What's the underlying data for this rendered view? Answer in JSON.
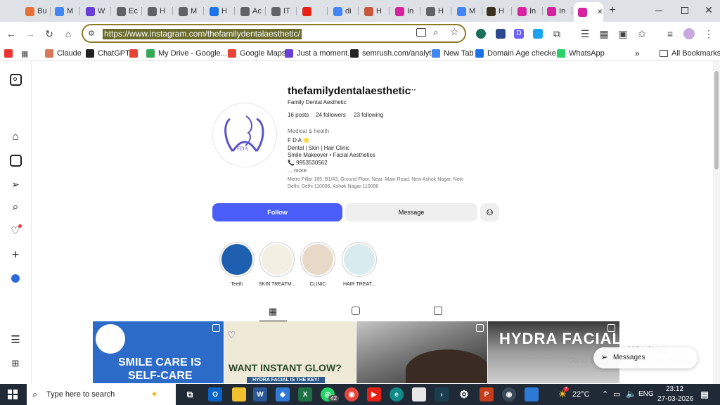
{
  "browser": {
    "tabs": [
      {
        "label": "Bu",
        "color": "#e8703a"
      },
      {
        "label": "M",
        "color": "#4285f4"
      },
      {
        "label": "W",
        "color": "#6a3fd6"
      },
      {
        "label": "Ec",
        "color": "#5f6368"
      },
      {
        "label": "H",
        "color": "#5f6368"
      },
      {
        "label": "M",
        "color": "#5f6368"
      },
      {
        "label": "H",
        "color": "#1a73e8"
      },
      {
        "label": "Ac",
        "color": "#5f6368"
      },
      {
        "label": "IT",
        "color": "#5f6368"
      },
      {
        "label": "",
        "color": "#e62117"
      },
      {
        "label": "di",
        "color": "#4285f4"
      },
      {
        "label": "H",
        "color": "#c8553d"
      },
      {
        "label": "In",
        "color": "#d6249f"
      },
      {
        "label": "H",
        "color": "#5f6368"
      },
      {
        "label": "M",
        "color": "#4285f4"
      },
      {
        "label": "H",
        "color": "#3b2f1e"
      },
      {
        "label": "In",
        "color": "#d6249f"
      },
      {
        "label": "In",
        "color": "#d6249f"
      },
      {
        "label": "",
        "color": "#d6249f"
      }
    ],
    "url": "https://www.instagram.com/thefamilydentalaesthetic/",
    "bookmarks": [
      {
        "label": "Claude",
        "color": "#d97757"
      },
      {
        "label": "ChatGPT",
        "color": "#222222"
      },
      {
        "label": "",
        "color": "#ea4335"
      },
      {
        "label": "My Drive - Google...",
        "color": "#34a853"
      },
      {
        "label": "Google Maps",
        "color": "#ea4335"
      },
      {
        "label": "Just a moment...",
        "color": "#6a3fd6"
      },
      {
        "label": "semrush.com/analyt...",
        "color": "#222222"
      },
      {
        "label": "New Tab",
        "color": "#4285f4"
      },
      {
        "label": "Domain Age checke...",
        "color": "#1a73e8"
      },
      {
        "label": "WhatsApp",
        "color": "#25d366"
      }
    ],
    "all_bookmarks": "All Bookmarks"
  },
  "profile": {
    "username": "thefamilydentalaesthetic",
    "more": "···",
    "display_name": "Family Dental Aesthetic",
    "posts": "16 posts",
    "followers": "24 followers",
    "following": "23 following",
    "category": "Medical & health",
    "bio_line1": "F D A 🌟",
    "bio_line2": "Dental | Skin | Hair Clinic",
    "bio_line3": "Smile Makeover • Facial Aesthetics",
    "bio_phone": "📞 9953530562",
    "bio_more": "... more",
    "address_line1": "Metro Pillar 165, B1/43, Ground Floor, Near, Main Road, New Ashok Nagar, New",
    "address_line2": "Delhi, Delhi 110096, Ashok Nagar 110096",
    "avatar_text": "FDA",
    "follow_label": "Follow",
    "message_label": "Message"
  },
  "highlights": [
    {
      "label": "Teeth",
      "color": "#1f5fb0"
    },
    {
      "label": "SKIN TREATM...",
      "color": "#f3efe2"
    },
    {
      "label": "CLINIC",
      "color": "#e8d8c8"
    },
    {
      "label": "HAIR TREAT...",
      "color": "#d8ecef"
    }
  ],
  "posts": [
    {
      "line1": "SMILE CARE IS",
      "line2": "SELF-CARE",
      "bg": "#2c6bc8"
    },
    {
      "line1": "WANT INSTANT GLOW?",
      "line2": "HYDRA FACIAL IS THE KEY!",
      "bg": "#efe9d8"
    },
    {
      "line1": "",
      "line2": "",
      "bg": "#8e8e8e"
    },
    {
      "line1": "HYDRA FACIAL",
      "line2": "",
      "bg": "#b8b8b8"
    }
  ],
  "overlay": {
    "watermark1": "Activate Windows",
    "watermark2": "Go to Settings to activate Windows.",
    "messages_label": "Messages"
  },
  "taskbar": {
    "search_placeholder": "Type here to search",
    "whatsapp_badge": "42",
    "temperature": "22°C",
    "weather_badge": "7",
    "language": "ENG",
    "time": "23:12",
    "date": "27-03-2026"
  }
}
